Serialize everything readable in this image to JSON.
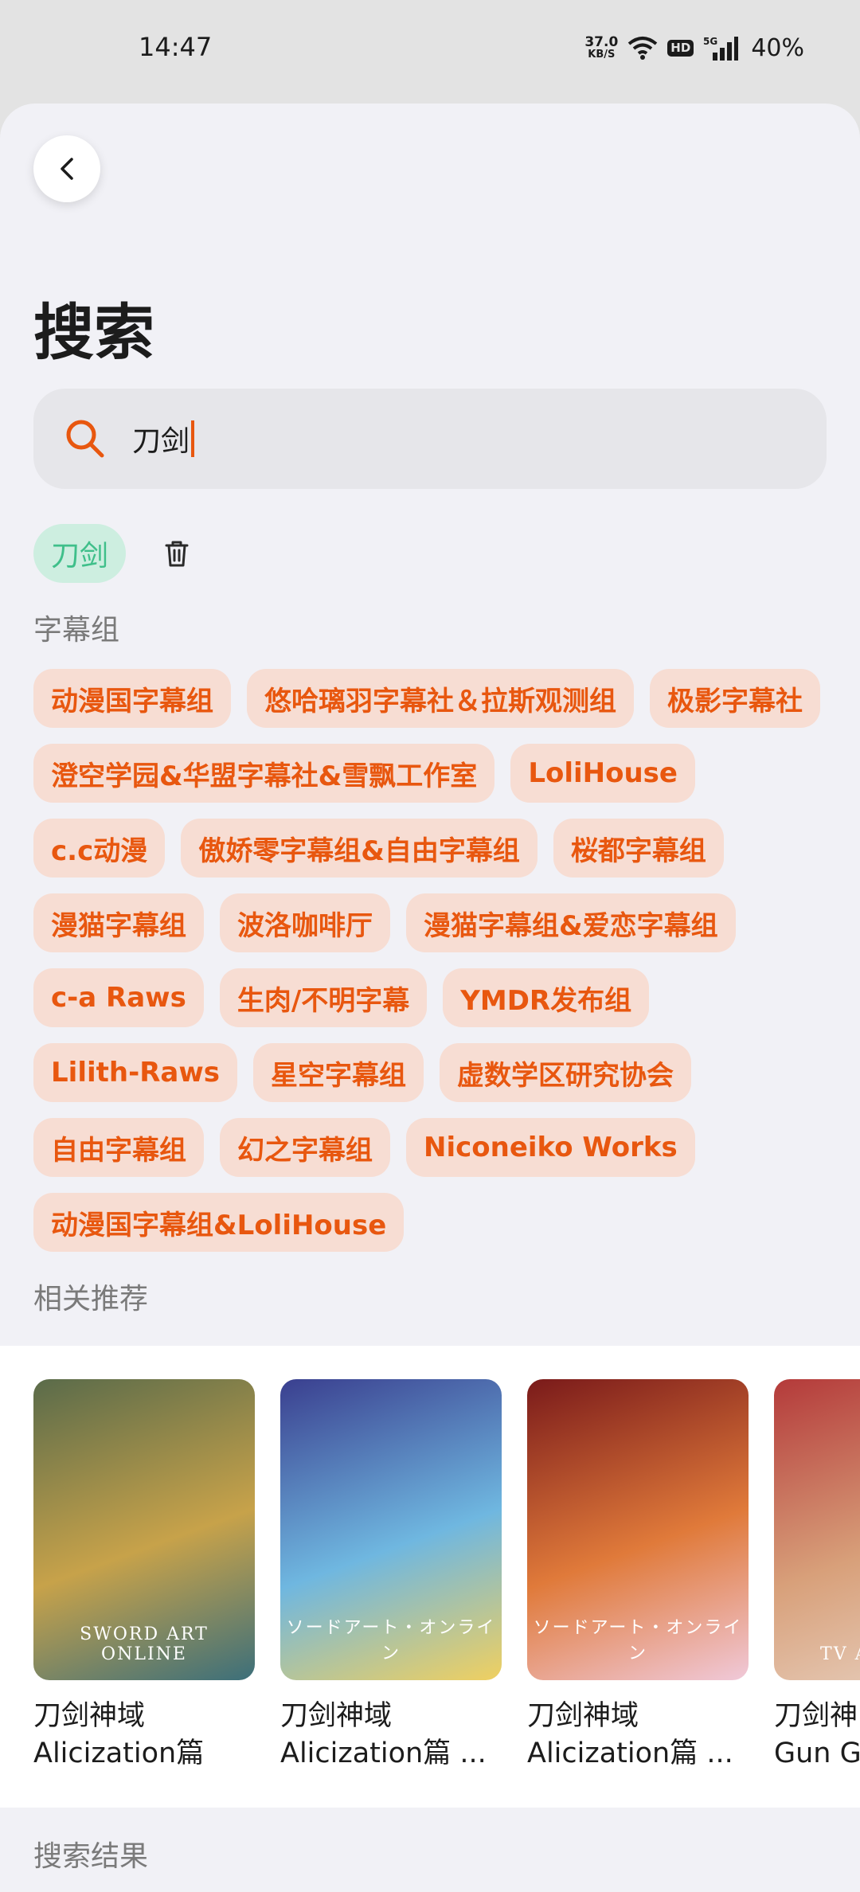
{
  "status": {
    "time": "14:47",
    "net_speed_value": "37.0",
    "net_speed_unit": "KB/S",
    "hd": "HD",
    "signal": "5G",
    "battery": "40%"
  },
  "title": "搜索",
  "search": {
    "value": "刀剑"
  },
  "history": {
    "items": [
      "刀剑"
    ]
  },
  "subtitle_groups": {
    "label": "字幕组",
    "tags": [
      "动漫国字幕组",
      "悠哈璃羽字幕社＆拉斯观测组",
      "极影字幕社",
      "澄空学园&华盟字幕社&雪飘工作室",
      "LoliHouse",
      "c.c动漫",
      "傲娇零字幕组&自由字幕组",
      "桜都字幕组",
      "漫猫字幕组",
      "波洛咖啡厅",
      "漫猫字幕组&爱恋字幕组",
      "c-a Raws",
      "生肉/不明字幕",
      "YMDR发布组",
      "Lilith-Raws",
      "星空字幕组",
      "虚数学区研究协会",
      "自由字幕组",
      "幻之字幕组",
      "Niconeiko Works",
      "动漫国字幕组&LoliHouse"
    ]
  },
  "recommend": {
    "label": "相关推荐",
    "items": [
      {
        "title": "刀剑神域\nAlicization篇",
        "caption": "SWORD ART ONLINE",
        "colors": [
          "#5a6b4a",
          "#c7a24a",
          "#3c6f7a"
        ]
      },
      {
        "title": "刀剑神域\nAlicization篇 ...",
        "caption": "ソードアート・オンライン",
        "colors": [
          "#3a3f8f",
          "#6fb7e0",
          "#f0d060"
        ]
      },
      {
        "title": "刀剑神域\nAlicization篇 ...",
        "caption": "ソードアート・オンライン",
        "colors": [
          "#7a1a1a",
          "#e07a3a",
          "#f0c9d9"
        ]
      },
      {
        "title": "刀剑神\nGun Ga",
        "caption": "TV ANIMATI",
        "colors": [
          "#b43a3a",
          "#d8a07a",
          "#e8d2c2"
        ]
      }
    ]
  },
  "results": {
    "label": "搜索结果"
  },
  "colors": {
    "accent": "#e8570f",
    "history_green": "#3fbf8a",
    "tag_bg": "#f7ddd3"
  }
}
